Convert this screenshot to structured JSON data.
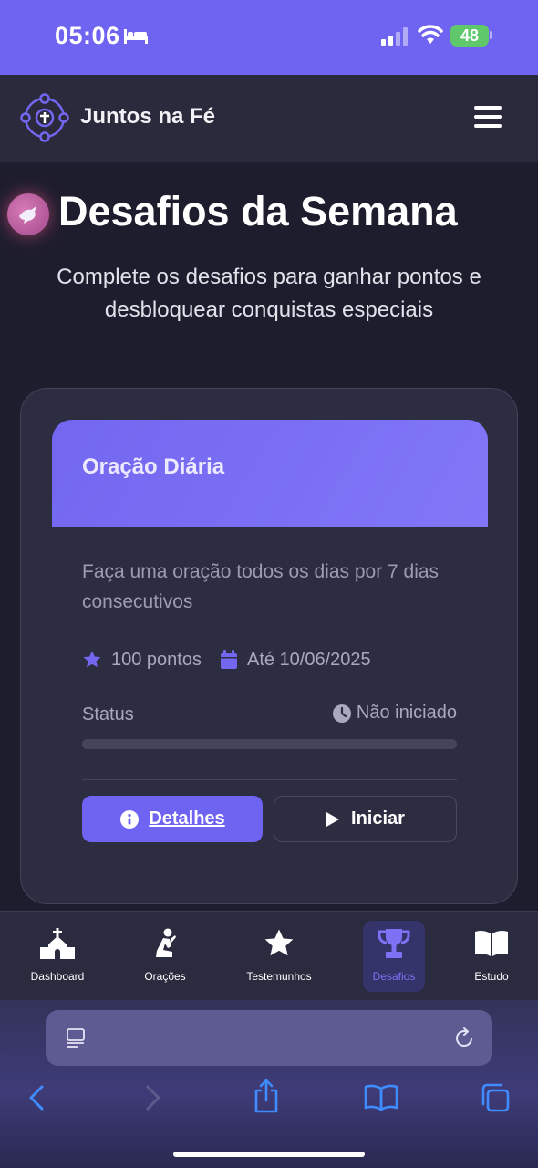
{
  "status_bar": {
    "time": "05:06",
    "battery": "48",
    "icons": [
      "bed-icon",
      "cellular-signal-icon",
      "wifi-icon",
      "battery-charging-icon"
    ]
  },
  "header": {
    "brand": "Juntos na Fé",
    "logo_icon": "community-logo-icon",
    "menu_icon": "hamburger-menu-icon"
  },
  "page": {
    "title_icon": "dove-icon",
    "title": "Desafios da Semana",
    "subtitle": "Complete os desafios para ganhar pontos e desbloquear conquistas especiais"
  },
  "challenge": {
    "title": "Oração Diária",
    "description": "Faça uma oração todos os dias por 7 dias consecutivos",
    "points": "100 pontos",
    "deadline": "Até 10/06/2025",
    "status_label": "Status",
    "status_value": "Não iniciado",
    "progress": 0,
    "details_label": "Detalhes",
    "start_label": "Iniciar"
  },
  "bottom_nav": {
    "items": [
      {
        "label": "Dashboard",
        "icon": "church-icon"
      },
      {
        "label": "Orações",
        "icon": "praying-person-icon"
      },
      {
        "label": "Testemunhos",
        "icon": "star-icon"
      },
      {
        "label": "Desafios",
        "icon": "trophy-icon",
        "active": true
      },
      {
        "label": "Estudo",
        "icon": "open-book-icon"
      }
    ]
  },
  "browser": {
    "icons": [
      "reader-mode-icon",
      "reload-icon",
      "back-icon",
      "forward-icon",
      "share-icon",
      "bookmarks-icon",
      "tabs-icon"
    ]
  },
  "colors": {
    "accent": "#6f63f2",
    "background": "#1e1d2e",
    "card": "#2d2d42",
    "muted_text": "#a9a8bc"
  }
}
